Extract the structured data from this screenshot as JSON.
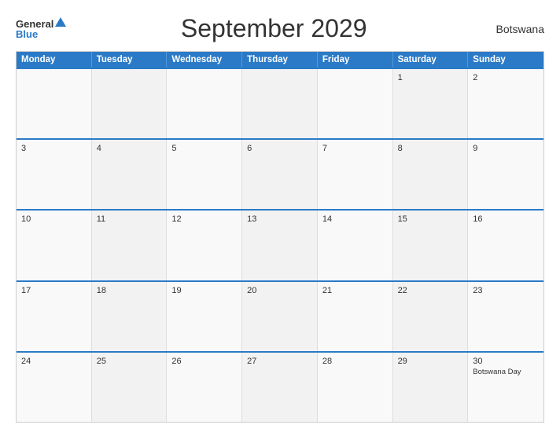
{
  "header": {
    "title": "September 2029",
    "country": "Botswana",
    "logo_general": "General",
    "logo_blue": "Blue"
  },
  "day_headers": [
    "Monday",
    "Tuesday",
    "Wednesday",
    "Thursday",
    "Friday",
    "Saturday",
    "Sunday"
  ],
  "weeks": [
    {
      "days": [
        {
          "num": "",
          "empty": true
        },
        {
          "num": "",
          "empty": true
        },
        {
          "num": "",
          "empty": true
        },
        {
          "num": "",
          "empty": true
        },
        {
          "num": "",
          "empty": true
        },
        {
          "num": "1",
          "event": ""
        },
        {
          "num": "2",
          "event": ""
        }
      ]
    },
    {
      "days": [
        {
          "num": "3",
          "event": ""
        },
        {
          "num": "4",
          "event": ""
        },
        {
          "num": "5",
          "event": ""
        },
        {
          "num": "6",
          "event": ""
        },
        {
          "num": "7",
          "event": ""
        },
        {
          "num": "8",
          "event": ""
        },
        {
          "num": "9",
          "event": ""
        }
      ]
    },
    {
      "days": [
        {
          "num": "10",
          "event": ""
        },
        {
          "num": "11",
          "event": ""
        },
        {
          "num": "12",
          "event": ""
        },
        {
          "num": "13",
          "event": ""
        },
        {
          "num": "14",
          "event": ""
        },
        {
          "num": "15",
          "event": ""
        },
        {
          "num": "16",
          "event": ""
        }
      ]
    },
    {
      "days": [
        {
          "num": "17",
          "event": ""
        },
        {
          "num": "18",
          "event": ""
        },
        {
          "num": "19",
          "event": ""
        },
        {
          "num": "20",
          "event": ""
        },
        {
          "num": "21",
          "event": ""
        },
        {
          "num": "22",
          "event": ""
        },
        {
          "num": "23",
          "event": ""
        }
      ]
    },
    {
      "days": [
        {
          "num": "24",
          "event": ""
        },
        {
          "num": "25",
          "event": ""
        },
        {
          "num": "26",
          "event": ""
        },
        {
          "num": "27",
          "event": ""
        },
        {
          "num": "28",
          "event": ""
        },
        {
          "num": "29",
          "event": ""
        },
        {
          "num": "30",
          "event": "Botswana Day"
        }
      ]
    }
  ]
}
